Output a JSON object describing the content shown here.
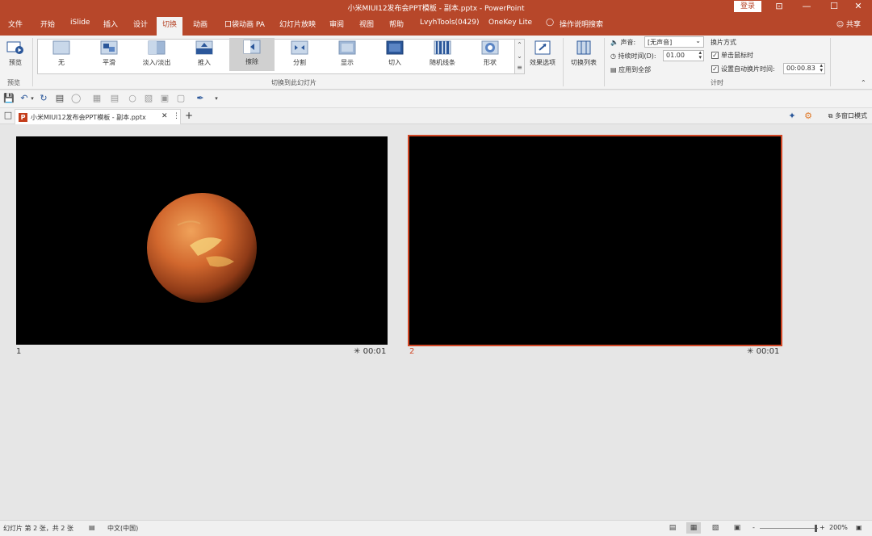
{
  "window": {
    "title": "小米MIUI12发布会PPT模板 - 副本.pptx  -  PowerPoint",
    "login_label": "登录",
    "minimize": "—",
    "maximize": "☐",
    "close": "✕",
    "restore": "⊡"
  },
  "tabs": [
    "文件",
    "开始",
    "iSlide",
    "插入",
    "设计",
    "切换",
    "动画",
    "口袋动画 PA",
    "幻灯片放映",
    "审阅",
    "视图",
    "帮助",
    "LvyhTools(0429)",
    "OneKey Lite",
    "操作说明搜索"
  ],
  "active_tab": "切换",
  "share_label": "共享",
  "ribbon": {
    "preview_label": "预览",
    "preview_group": "预览",
    "transitions": [
      {
        "label": "无",
        "icon": "none-transition-icon"
      },
      {
        "label": "平滑",
        "icon": "morph-transition-icon"
      },
      {
        "label": "淡入/淡出",
        "icon": "fade-transition-icon"
      },
      {
        "label": "推入",
        "icon": "push-transition-icon"
      },
      {
        "label": "擦除",
        "icon": "wipe-transition-icon"
      },
      {
        "label": "分割",
        "icon": "split-transition-icon"
      },
      {
        "label": "显示",
        "icon": "reveal-transition-icon"
      },
      {
        "label": "切入",
        "icon": "cut-transition-icon"
      },
      {
        "label": "随机线条",
        "icon": "random-bars-transition-icon"
      },
      {
        "label": "形状",
        "icon": "shape-transition-icon"
      }
    ],
    "selected_transition": "擦除",
    "effect_options_label": "效果选项",
    "transitions_group": "切换到此幻灯片",
    "transition_list_label": "切换列表",
    "sound_label": "声音:",
    "sound_value": "[无声音]",
    "duration_label": "持续时间(D):",
    "duration_value": "01.00",
    "apply_all_label": "应用到全部",
    "advance_label": "换片方式",
    "on_click_label": "单击鼠标时",
    "after_label": "设置自动换片时间:",
    "after_value": "00:00.83",
    "timing_group": "计时"
  },
  "doc_tab": {
    "title": "小米MIUI12发布会PPT模板 - 副本.pptx",
    "close": "✕",
    "more": "⋮",
    "add": "+"
  },
  "multi_window_label": "多窗口模式",
  "slides": [
    {
      "number": "1",
      "time": "00:01",
      "has_planet": true
    },
    {
      "number": "2",
      "time": "00:01",
      "has_planet": false
    }
  ],
  "status": {
    "slide_info": "幻灯片 第 2 张，共 2 张",
    "language": "中文(中国)",
    "zoom": "200%",
    "zoom_minus": "-",
    "zoom_plus": "+"
  },
  "colors": {
    "accent": "#b7472a",
    "selection": "#d24726"
  }
}
